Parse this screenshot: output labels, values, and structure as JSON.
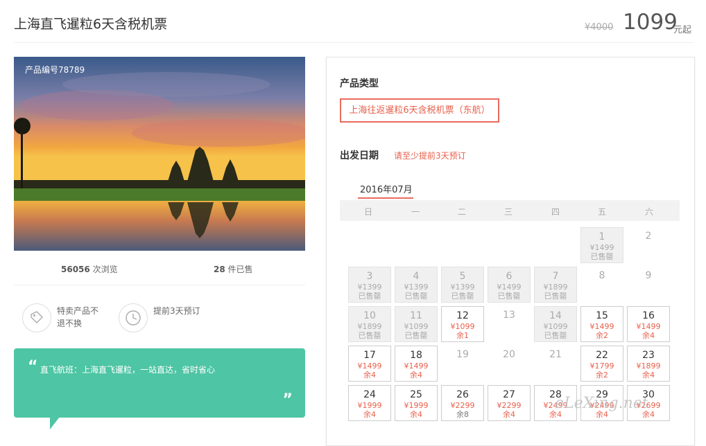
{
  "header": {
    "title": "上海直飞暹粒6天含税机票",
    "old_price": "¥4000",
    "price": "1099",
    "price_suffix": "元起"
  },
  "photo": {
    "product_no": "产品编号78789"
  },
  "stats": {
    "views_num": "56056",
    "views_label": "次浏览",
    "sold_num": "28",
    "sold_label": "件已售"
  },
  "features": [
    {
      "icon": "tag-icon",
      "text": "特卖产品不退不换"
    },
    {
      "icon": "clock-icon",
      "text": "提前3天预订"
    }
  ],
  "highlight": {
    "open_quote": "“",
    "text": "直飞航班：上海直飞暹粒，一站直达，省时省心",
    "close_quote": "”"
  },
  "panel": {
    "type_label": "产品类型",
    "type_option": "上海往返暹粒6天含税机票（东航）",
    "date_label": "出发日期",
    "date_hint": "请至少提前3天预订",
    "month": "2016年07月",
    "weekdays": [
      "日",
      "一",
      "二",
      "三",
      "四",
      "五",
      "六"
    ]
  },
  "calendar": [
    {
      "d": "1",
      "p": "¥1499",
      "r": "已售罄",
      "s": "sold"
    },
    {
      "d": "2",
      "s": "plain"
    },
    {
      "d": "3",
      "p": "¥1399",
      "r": "已售罄",
      "s": "sold"
    },
    {
      "d": "4",
      "p": "¥1399",
      "r": "已售罄",
      "s": "sold"
    },
    {
      "d": "5",
      "p": "¥1399",
      "r": "已售罄",
      "s": "sold"
    },
    {
      "d": "6",
      "p": "¥1499",
      "r": "已售罄",
      "s": "sold"
    },
    {
      "d": "7",
      "p": "¥1899",
      "r": "已售罄",
      "s": "sold"
    },
    {
      "d": "8",
      "s": "plain"
    },
    {
      "d": "9",
      "s": "plain"
    },
    {
      "d": "10",
      "p": "¥1899",
      "r": "已售罄",
      "s": "sold"
    },
    {
      "d": "11",
      "p": "¥1099",
      "r": "已售罄",
      "s": "sold"
    },
    {
      "d": "12",
      "p": "¥1099",
      "r": "余1",
      "s": "cur"
    },
    {
      "d": "13",
      "s": "plain"
    },
    {
      "d": "14",
      "p": "¥1099",
      "r": "已售罄",
      "s": "sold"
    },
    {
      "d": "15",
      "p": "¥1499",
      "r": "余2",
      "s": "cur"
    },
    {
      "d": "16",
      "p": "¥1499",
      "r": "余4",
      "s": "cur"
    },
    {
      "d": "17",
      "p": "¥1499",
      "r": "余4",
      "s": "cur"
    },
    {
      "d": "18",
      "p": "¥1499",
      "r": "余4",
      "s": "cur"
    },
    {
      "d": "19",
      "s": "plain"
    },
    {
      "d": "20",
      "s": "plain"
    },
    {
      "d": "21",
      "s": "plain"
    },
    {
      "d": "22",
      "p": "¥1799",
      "r": "余2",
      "s": "cur"
    },
    {
      "d": "23",
      "p": "¥1899",
      "r": "余4",
      "s": "cur"
    },
    {
      "d": "24",
      "p": "¥1999",
      "r": "余4",
      "s": "cur"
    },
    {
      "d": "25",
      "p": "¥1999",
      "r": "余4",
      "s": "cur"
    },
    {
      "d": "26",
      "p": "¥2299",
      "r": "余8",
      "s": "cur",
      "grey": true
    },
    {
      "d": "27",
      "p": "¥2299",
      "r": "余4",
      "s": "cur"
    },
    {
      "d": "28",
      "p": "¥2499",
      "r": "余4",
      "s": "cur"
    },
    {
      "d": "29",
      "p": "¥2499",
      "r": "余4",
      "s": "cur"
    },
    {
      "d": "30",
      "p": "¥2699",
      "r": "余4",
      "s": "cur"
    }
  ],
  "watermark": "eLeXing.net"
}
